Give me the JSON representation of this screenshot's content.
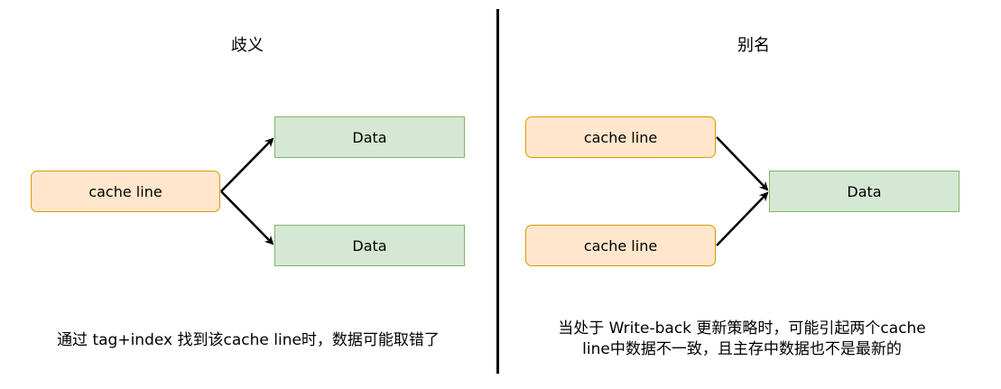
{
  "left": {
    "title": "歧义",
    "source": "cache line",
    "targets": [
      "Data",
      "Data"
    ],
    "caption": "通过 tag+index 找到该cache line时，数据可能取错了"
  },
  "right": {
    "title": "别名",
    "sources": [
      "cache line",
      "cache line"
    ],
    "target": "Data",
    "caption_line1": "当处于 Write-back 更新策略时，可能引起两个cache",
    "caption_line2": "line中数据不一致，且主存中数据也不是最新的"
  }
}
